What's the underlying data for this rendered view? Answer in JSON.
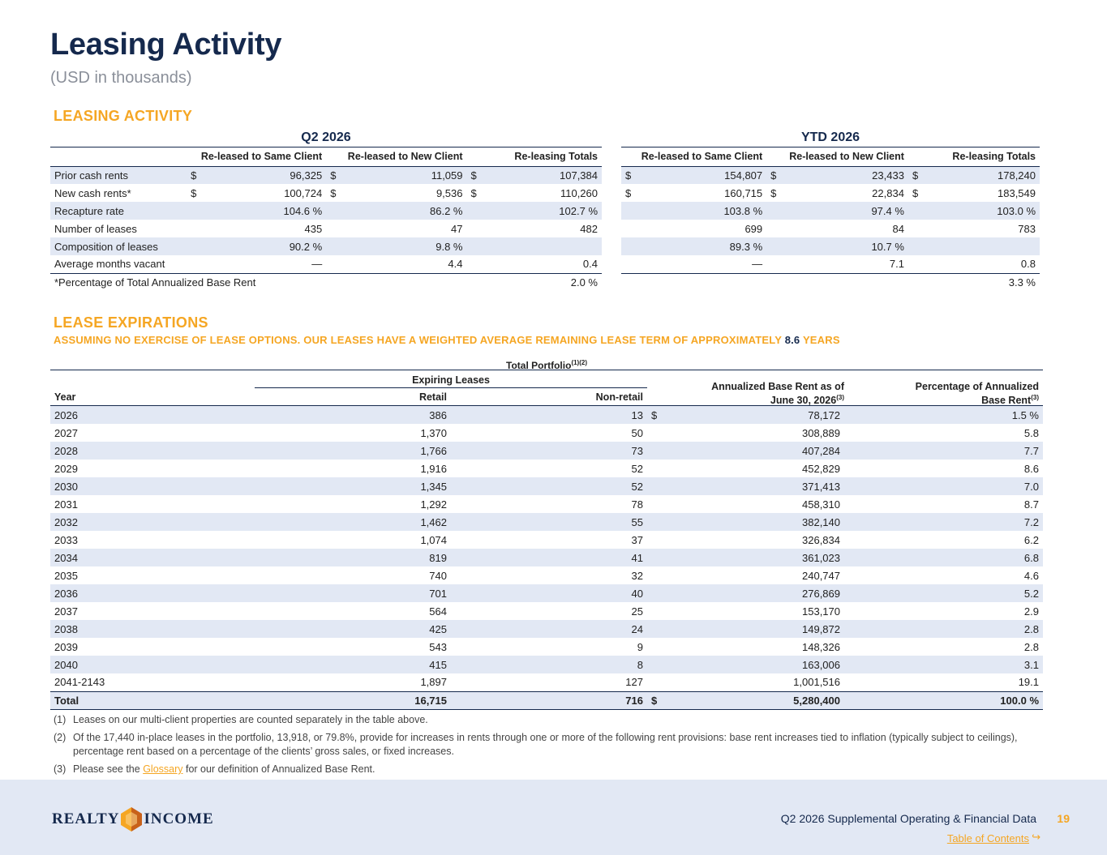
{
  "page": {
    "title": "Leasing Activity",
    "subtitle": "(USD in thousands)"
  },
  "leasing": {
    "heading": "LEASING ACTIVITY",
    "col_headers": [
      "Re-leased to Same Client",
      "Re-leased to New Client",
      "Re-leasing Totals"
    ],
    "q2": {
      "period": "Q2 2026",
      "rows": [
        {
          "label": "Prior cash rents",
          "cur": [
            "$",
            "$",
            "$"
          ],
          "vals": [
            "96,325",
            "11,059",
            "107,384"
          ]
        },
        {
          "label": "New cash rents*",
          "cur": [
            "$",
            "$",
            "$"
          ],
          "vals": [
            "100,724",
            "9,536",
            "110,260"
          ]
        },
        {
          "label": "Recapture rate",
          "cur": [
            "",
            "",
            ""
          ],
          "vals": [
            "104.6 %",
            "86.2 %",
            "102.7 %"
          ]
        },
        {
          "label": "Number of leases",
          "cur": [
            "",
            "",
            ""
          ],
          "vals": [
            "435",
            "47",
            "482"
          ]
        },
        {
          "label": "Composition of leases",
          "cur": [
            "",
            "",
            ""
          ],
          "vals": [
            "90.2 %",
            "9.8 %",
            ""
          ]
        },
        {
          "label": "Average months vacant",
          "cur": [
            "",
            "",
            ""
          ],
          "vals": [
            "—",
            "4.4",
            "0.4"
          ]
        }
      ],
      "note_label": "*Percentage of Total Annualized Base Rent",
      "note_value": "2.0 %"
    },
    "ytd": {
      "period": "YTD 2026",
      "rows": [
        {
          "cur": [
            "$",
            "$",
            "$"
          ],
          "vals": [
            "154,807",
            "23,433",
            "178,240"
          ]
        },
        {
          "cur": [
            "$",
            "$",
            "$"
          ],
          "vals": [
            "160,715",
            "22,834",
            "183,549"
          ]
        },
        {
          "cur": [
            "",
            "",
            ""
          ],
          "vals": [
            "103.8 %",
            "97.4 %",
            "103.0 %"
          ]
        },
        {
          "cur": [
            "",
            "",
            ""
          ],
          "vals": [
            "699",
            "84",
            "783"
          ]
        },
        {
          "cur": [
            "",
            "",
            ""
          ],
          "vals": [
            "89.3 %",
            "10.7 %",
            ""
          ]
        },
        {
          "cur": [
            "",
            "",
            ""
          ],
          "vals": [
            "—",
            "7.1",
            "0.8"
          ]
        }
      ],
      "note_value": "3.3 %"
    }
  },
  "expirations": {
    "heading": "LEASE EXPIRATIONS",
    "sub_prefix": "ASSUMING NO EXERCISE OF LEASE OPTIONS. OUR LEASES HAVE A WEIGHTED AVERAGE REMAINING LEASE TERM OF APPROXIMATELY",
    "sub_value": "8.6",
    "sub_suffix": "YEARS",
    "caption": "Total Portfolio",
    "caption_sup": "(1)(2)",
    "h_expiring": "Expiring Leases",
    "h_year": "Year",
    "h_retail": "Retail",
    "h_nonretail": "Non-retail",
    "h_abr_1": "Annualized Base Rent as of",
    "h_abr_2": "June 30, 2026",
    "h_abr_sup": "(3)",
    "h_pct_1": "Percentage of Annualized",
    "h_pct_2": "Base Rent",
    "h_pct_sup": "(3)",
    "rows": [
      {
        "year": "2026",
        "retail": "386",
        "nonretail": "13",
        "cur": "$",
        "abr": "78,172",
        "pct": "1.5 %"
      },
      {
        "year": "2027",
        "retail": "1,370",
        "nonretail": "50",
        "cur": "",
        "abr": "308,889",
        "pct": "5.8"
      },
      {
        "year": "2028",
        "retail": "1,766",
        "nonretail": "73",
        "cur": "",
        "abr": "407,284",
        "pct": "7.7"
      },
      {
        "year": "2029",
        "retail": "1,916",
        "nonretail": "52",
        "cur": "",
        "abr": "452,829",
        "pct": "8.6"
      },
      {
        "year": "2030",
        "retail": "1,345",
        "nonretail": "52",
        "cur": "",
        "abr": "371,413",
        "pct": "7.0"
      },
      {
        "year": "2031",
        "retail": "1,292",
        "nonretail": "78",
        "cur": "",
        "abr": "458,310",
        "pct": "8.7"
      },
      {
        "year": "2032",
        "retail": "1,462",
        "nonretail": "55",
        "cur": "",
        "abr": "382,140",
        "pct": "7.2"
      },
      {
        "year": "2033",
        "retail": "1,074",
        "nonretail": "37",
        "cur": "",
        "abr": "326,834",
        "pct": "6.2"
      },
      {
        "year": "2034",
        "retail": "819",
        "nonretail": "41",
        "cur": "",
        "abr": "361,023",
        "pct": "6.8"
      },
      {
        "year": "2035",
        "retail": "740",
        "nonretail": "32",
        "cur": "",
        "abr": "240,747",
        "pct": "4.6"
      },
      {
        "year": "2036",
        "retail": "701",
        "nonretail": "40",
        "cur": "",
        "abr": "276,869",
        "pct": "5.2"
      },
      {
        "year": "2037",
        "retail": "564",
        "nonretail": "25",
        "cur": "",
        "abr": "153,170",
        "pct": "2.9"
      },
      {
        "year": "2038",
        "retail": "425",
        "nonretail": "24",
        "cur": "",
        "abr": "149,872",
        "pct": "2.8"
      },
      {
        "year": "2039",
        "retail": "543",
        "nonretail": "9",
        "cur": "",
        "abr": "148,326",
        "pct": "2.8"
      },
      {
        "year": "2040",
        "retail": "415",
        "nonretail": "8",
        "cur": "",
        "abr": "163,006",
        "pct": "3.1"
      },
      {
        "year": "2041-2143",
        "retail": "1,897",
        "nonretail": "127",
        "cur": "",
        "abr": "1,001,516",
        "pct": "19.1"
      }
    ],
    "total": {
      "year": "Total",
      "retail": "16,715",
      "nonretail": "716",
      "cur": "$",
      "abr": "5,280,400",
      "pct": "100.0 %"
    }
  },
  "footnotes": [
    {
      "num": "(1)",
      "text": "Leases on our multi-client properties are counted separately in the table above."
    },
    {
      "num": "(2)",
      "text": "Of the 17,440 in-place leases in the portfolio, 13,918, or 79.8%, provide for increases in rents through one or more of the following rent provisions: base rent increases tied to inflation (typically subject to ceilings), percentage rent based on a percentage of the clients’ gross sales, or fixed increases."
    },
    {
      "num": "(3)",
      "text_before": "Please see the",
      "link": "Glossary",
      "text_after": "for our definition of Annualized Base Rent."
    }
  ],
  "footer": {
    "logo_left": "REALTY",
    "logo_right": "INCOME",
    "title": "Q2 2026 Supplemental Operating & Financial Data",
    "page": "19",
    "toc": "Table of Contents",
    "toc_arrow": "↪"
  },
  "colors": {
    "navy": "#15294d",
    "orange": "#f5a623",
    "shade": "#e2e8f4"
  }
}
